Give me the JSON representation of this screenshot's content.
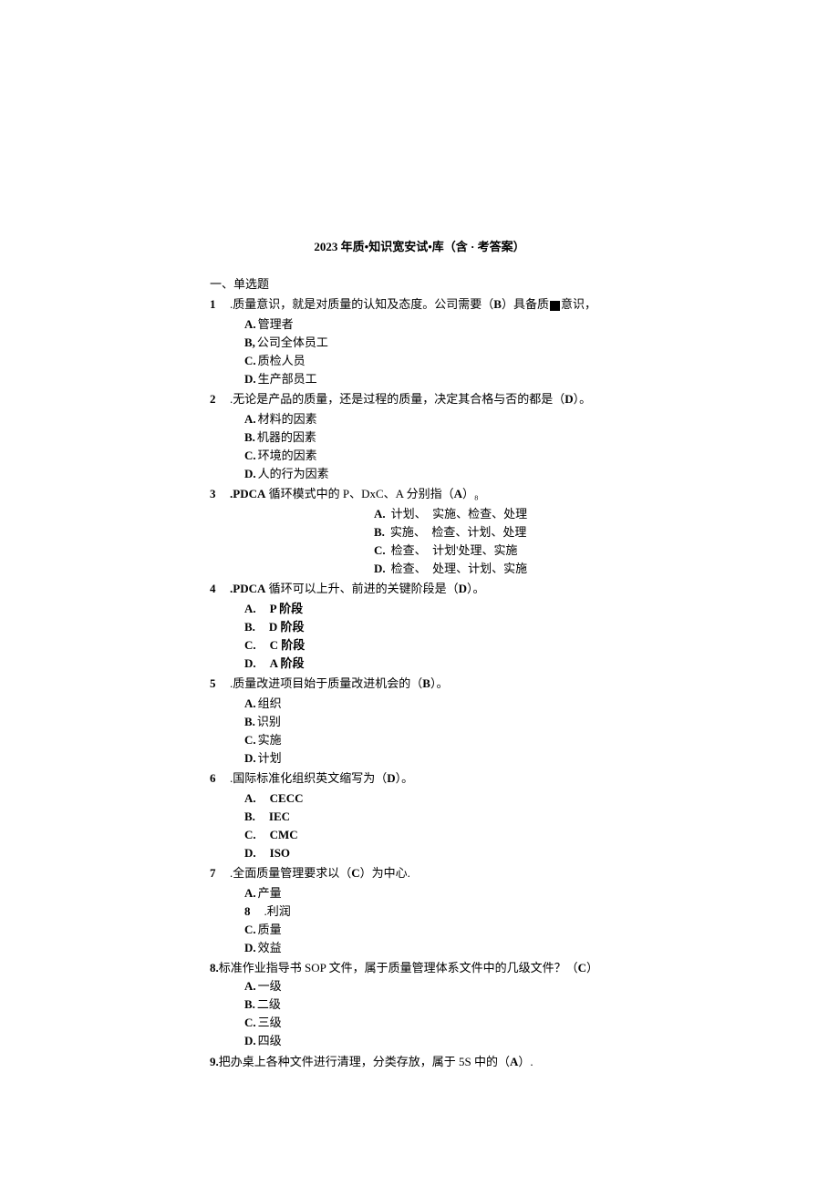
{
  "title": "2023 年质•知识宽安试•库（含 · 考答案）",
  "sectionHead": "一、单选题",
  "questions": [
    {
      "num": "1",
      "text_before": ".质量意识，就是对质量的认知及态度。公司需要（",
      "answer": "B",
      "text_after": "）具备质",
      "tail": "意识，",
      "opts": [
        {
          "label": "A.",
          "text": "管理者"
        },
        {
          "label": "B,",
          "text": "公司全体员工"
        },
        {
          "label": "C.",
          "text": "质检人员"
        },
        {
          "label": "D.",
          "text": "生产部员工"
        }
      ]
    },
    {
      "num": "2",
      "text": ".无论是产品的质量，还是过程的质量，决定其合格与否的都是（",
      "answer": "D",
      "after": "）。",
      "opts": [
        {
          "label": "A.",
          "text": "材料的因素"
        },
        {
          "label": "B.",
          "text": "机器的因素"
        },
        {
          "label": "C.",
          "text": "环境的因素"
        },
        {
          "label": "D.",
          "text": "人的行为因素"
        }
      ]
    },
    {
      "num": "3",
      "prefix": ".PDCA",
      "text": " 循环模式中的 P、DxC、A 分别指（",
      "answer": "A",
      "after": "）",
      "tailGlyph": "₈",
      "centerOpts": [
        {
          "label": "A.",
          "text": "计划、　实施、检查、处理"
        },
        {
          "label": "B.",
          "text": "实施、　检查、计划、处理"
        },
        {
          "label": "C.",
          "text": "检查、　计划'处理、实施"
        },
        {
          "label": "D.",
          "text": "检查、　处理、计划、实施"
        }
      ]
    },
    {
      "num": "4",
      "prefix": ".PDCA",
      "text": " 循环可以上升、前进的关键阶段是（",
      "answer": "D",
      "after": "）。",
      "opts": [
        {
          "label": "A.",
          "text": "　P 阶段"
        },
        {
          "label": "B.",
          "text": "　D 阶段"
        },
        {
          "label": "C.",
          "text": "　C 阶段"
        },
        {
          "label": "D.",
          "text": "　A 阶段"
        }
      ]
    },
    {
      "num": "5",
      "text": ".质量改进项目始于质量改进机会的（",
      "answer": "B",
      "after": "）。",
      "opts": [
        {
          "label": "A.",
          "text": "组织"
        },
        {
          "label": "B.",
          "text": "识别"
        },
        {
          "label": "C.",
          "text": "实施"
        },
        {
          "label": "D.",
          "text": "计划"
        }
      ]
    },
    {
      "num": "6",
      "text": ".国际标准化组织英文缩写为（",
      "answer": "D",
      "after": "）。",
      "opts": [
        {
          "label": "A.",
          "text": "　CECC"
        },
        {
          "label": "B.",
          "text": "　IEC"
        },
        {
          "label": "C.",
          "text": "　CMC"
        },
        {
          "label": "D.",
          "text": "　ISO"
        }
      ]
    },
    {
      "num": "7",
      "text": ".全面质量管理要求以（",
      "answer": "C",
      "after": "）为中心.",
      "opts": [
        {
          "label": "A.",
          "text": "产量"
        },
        {
          "label": "8",
          "text": "　.利润",
          "special": true
        },
        {
          "label": "C.",
          "text": "质量"
        },
        {
          "label": "D.",
          "text": "效益"
        }
      ]
    },
    {
      "num": "8.",
      "text": "标准作业指导书 SOP 文件，属于质量管理体系文件中的几级文件？（",
      "answer": "C",
      "after": "）",
      "flat": true,
      "opts": [
        {
          "label": "A.",
          "text": "一级"
        },
        {
          "label": "B.",
          "text": "二级"
        },
        {
          "label": "C.",
          "text": "三级"
        },
        {
          "label": "D.",
          "text": "四级"
        }
      ]
    },
    {
      "num": "9.",
      "text": "把办桌上各种文件进行清理，分类存放，属于 5S 中的（",
      "answer": "A",
      "after": "）.",
      "flat": true
    }
  ]
}
